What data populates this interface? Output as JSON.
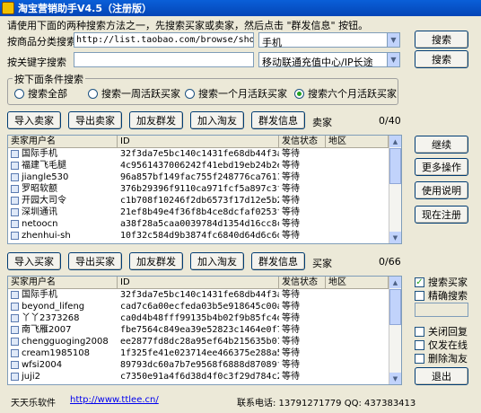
{
  "window": {
    "title": "淘宝营销助手V4.5（注册版）"
  },
  "hint": "请使用下面的两种搜索方法之一，先搜索买家或卖家，然后点击 \"群发信息\" 按钮。",
  "search": {
    "category_label": "按商品分类搜索",
    "category_url": "http://list.taobao.com/browse/shop-13.ht",
    "category_select": "手机",
    "category_button": "搜索",
    "keyword_label": "按关键字搜索",
    "keyword_value": "",
    "keyword_select": "移动联通充值中心/IP长途",
    "keyword_button": "搜索"
  },
  "conditions": {
    "title": "按下面条件搜索",
    "options": [
      "搜索全部",
      "搜索一周活跃买家",
      "搜索一个月活跃买家",
      "搜索六个月活跃买家"
    ],
    "selected_index": 3
  },
  "seller_toolbar": {
    "import": "导入卖家",
    "export": "导出卖家",
    "mass": "加友群发",
    "add": "加入淘友",
    "send": "群发信息",
    "label": "卖家",
    "count": "0/40"
  },
  "seller_table": {
    "headers": [
      "卖家用户名",
      "ID",
      "发信状态",
      "地区"
    ],
    "rows": [
      [
        "国际手机",
        "32f3da7e5bc140c1431fe68db44f3a74",
        "等待",
        ""
      ],
      [
        "福建飞毛腿",
        "4c9561437006242f41ebd19eb24b2e7d",
        "等待",
        ""
      ],
      [
        "jiangle530",
        "96a857bf149fac755f248776ca7611cb",
        "等待",
        ""
      ],
      [
        "罗昭软额",
        "376b29396f9110ca971fcf5a897c3f1f",
        "等待",
        ""
      ],
      [
        "开园大司令",
        "c1b708f10246f2db6573f17d12e5b2a268",
        "等待",
        ""
      ],
      [
        "深圳通讯",
        "21ef8b49e4f36f8b4ce8dcfaf0253fe2",
        "等待",
        ""
      ],
      [
        "netoocn",
        "a38f28a5caa0039784d1354d16cc8c7a",
        "等待",
        ""
      ],
      [
        "zhenhui-sh",
        "10f32c584d9b3874fc6840d64d6c6d04",
        "等待",
        ""
      ]
    ]
  },
  "buyer_toolbar": {
    "import": "导入买家",
    "export": "导出买家",
    "mass": "加友群发",
    "add": "加入淘友",
    "send": "群发信息",
    "label": "买家",
    "count": "0/66"
  },
  "buyer_table": {
    "headers": [
      "买家用户名",
      "ID",
      "发信状态",
      "地区"
    ],
    "rows": [
      [
        "国际手机",
        "32f3da7e5bc140c1431fe68db44f3a74",
        "等待",
        ""
      ],
      [
        "beyond_lifeng",
        "cad7c6a00ecfeda03b5e918645c00a01",
        "等待",
        ""
      ],
      [
        "丫丫2373268",
        "ca0d4b48fff99135b4b02f9b85fc4d",
        "等待",
        ""
      ],
      [
        "南飞雁2007",
        "fbe7564c849ea39e52823c1464e0f70d",
        "等待",
        ""
      ],
      [
        "chengguoging2008",
        "ee2877fd8dc28a95ef64b215635b013d",
        "等待",
        ""
      ],
      [
        "cream1985108",
        "1f325fe41e023714ee466375e288a5fd",
        "等待",
        ""
      ],
      [
        "wfsi2004",
        "89793dc60a7b7e9568f6888d87089f04",
        "等待",
        ""
      ],
      [
        "juji2",
        "c7350e91a4f6d38d4f0c3f29d784c2f1b",
        "等待",
        ""
      ]
    ]
  },
  "side": {
    "continue": "继续",
    "more": "更多操作",
    "help": "使用说明",
    "register": "现在注册",
    "search_buyer": "搜索买家",
    "precise": "精确搜索",
    "close_reply": "关闭回复",
    "only_online": "仅发在线",
    "delete_friend": "删除淘友",
    "exit": "退出"
  },
  "footer": {
    "company": "天天乐软件",
    "url": "http://www.ttlee.cn/",
    "contact": "联系电话: 13791271779    QQ: 437383413"
  }
}
